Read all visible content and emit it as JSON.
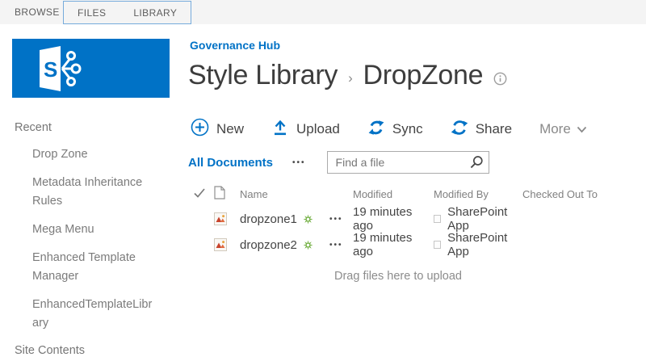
{
  "colors": {
    "brand_blue": "#0072c6",
    "tab_group_border": "#76abdc",
    "new_badge_green": "#73b043",
    "file_icon_red": "#c8432c",
    "ribbon_background": "#f4f4f4"
  },
  "ribbon": {
    "tabs": [
      {
        "label": "BROWSE"
      },
      {
        "label": "FILES"
      },
      {
        "label": "LIBRARY"
      }
    ]
  },
  "logo": {
    "letter": "S"
  },
  "sidebar": {
    "recent_label": "Recent",
    "items": [
      "Drop Zone",
      "Metadata Inheritance Rules",
      "Mega Menu",
      "Enhanced Template Manager",
      "EnhancedTemplateLibrary"
    ],
    "site_contents_label": "Site Contents"
  },
  "header": {
    "breadcrumb": "Governance Hub",
    "title_primary": "Style Library",
    "title_separator": "›",
    "title_secondary": "DropZone"
  },
  "toolbar": {
    "new_label": "New",
    "upload_label": "Upload",
    "sync_label": "Sync",
    "share_label": "Share",
    "more_label": "More"
  },
  "view_bar": {
    "view_name": "All Documents",
    "menu_dots": "•••",
    "search_placeholder": "Find a file"
  },
  "table": {
    "headers": {
      "name": "Name",
      "modified": "Modified",
      "modified_by": "Modified By",
      "checked_out_to": "Checked Out To"
    },
    "rows": [
      {
        "name": "dropzone1",
        "menu_dots": "•••",
        "modified": "19 minutes ago",
        "modified_by": "SharePoint App",
        "is_new": true
      },
      {
        "name": "dropzone2",
        "menu_dots": "•••",
        "modified": "19 minutes ago",
        "modified_by": "SharePoint App",
        "is_new": true
      }
    ]
  },
  "upload_hint": "Drag files here to upload",
  "icons": {
    "new": "plus-circle-icon",
    "upload": "upload-arrow-icon",
    "sync": "sync-arrows-icon",
    "share": "share-circle-icon",
    "more": "chevron-down-icon",
    "search": "magnifier-icon",
    "info": "info-circle-icon",
    "select_all": "checkmark-icon",
    "file_column": "document-icon",
    "file_type": "image-file-icon",
    "new_badge": "green-starburst-icon",
    "presence": "presence-square-icon"
  }
}
